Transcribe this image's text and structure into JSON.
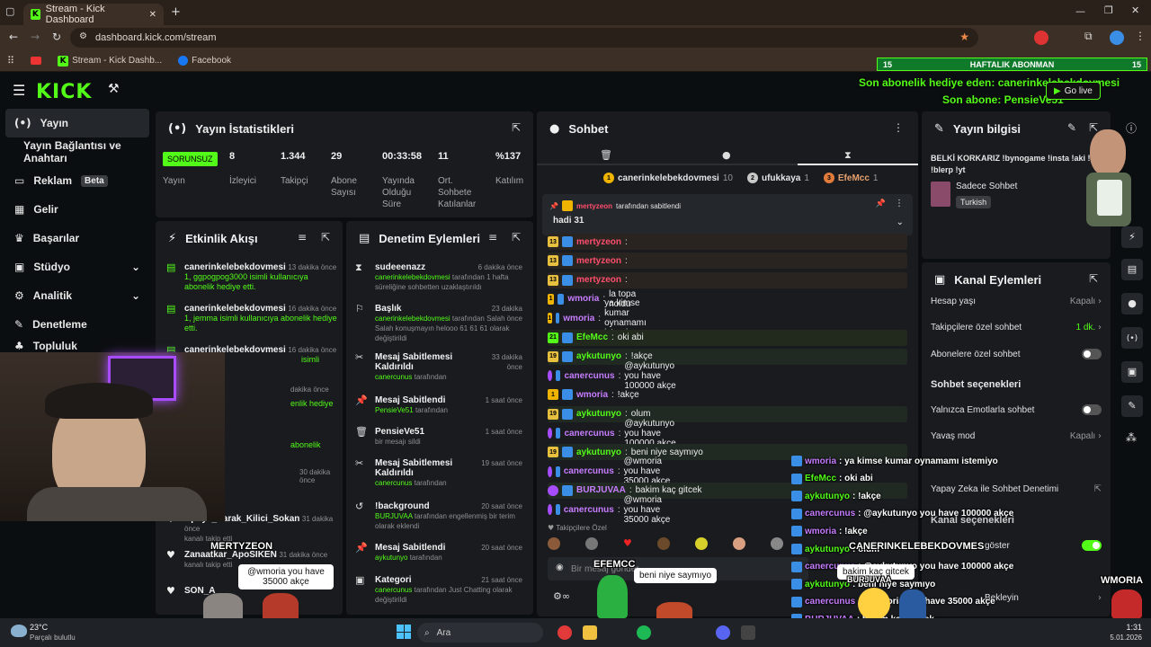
{
  "browser": {
    "tab_title": "Stream - Kick Dashboard",
    "url": "dashboard.kick.com/stream",
    "bookmarks": [
      "Stream - Kick Dashb...",
      "Facebook"
    ]
  },
  "overlay_top": {
    "sub_goal_left": "15",
    "sub_goal_label": "HAFTALIK ABONMAN",
    "sub_goal_right": "15",
    "gift_line": "Son abonelik hediye eden: canerinkelebekdovmesi",
    "sub_line": "Son abone: PensieVe51",
    "go_live": "Go live"
  },
  "sidebar": {
    "items": [
      {
        "label": "Yayın",
        "icon": "broadcast-icon"
      },
      {
        "label": "Yayın Bağlantısı ve Anahtarı",
        "icon": ""
      },
      {
        "label": "Reklam",
        "icon": "ad-icon",
        "badge": "Beta"
      },
      {
        "label": "Gelir",
        "icon": "chart-icon"
      },
      {
        "label": "Başarılar",
        "icon": "trophy-icon"
      },
      {
        "label": "Stüdyo",
        "icon": "studio-icon"
      },
      {
        "label": "Analitik",
        "icon": "analytics-icon"
      },
      {
        "label": "Denetleme",
        "icon": "wrench-icon"
      },
      {
        "label": "Topluluk",
        "icon": "community-icon"
      }
    ]
  },
  "stats": {
    "title": "Yayın İstatistikleri",
    "status": "SORUNSUZ",
    "status_label": "Yayın",
    "items": [
      {
        "value": "8",
        "label": "İzleyici"
      },
      {
        "value": "1.344",
        "label": "Takipçi"
      },
      {
        "value": "29",
        "label": "Abone Sayısı"
      },
      {
        "value": "00:33:58",
        "label": "Yayında Olduğu Süre"
      },
      {
        "value": "11",
        "label": "Ort. Sohbete Katılanlar"
      },
      {
        "value": "%137",
        "label": "Katılım"
      }
    ]
  },
  "activity": {
    "title": "Etkinlik Akışı",
    "items": [
      {
        "name": "canerinkelebekdovmesi",
        "time": "13 dakika önce",
        "desc": "1, ggpogpog3000 isimli kullanıcıya abonelik hediye etti."
      },
      {
        "name": "canerinkelebekdovmesi",
        "time": "16 dakika önce",
        "desc": "1, jemma isimli kullanıcıya abonelik hediye etti."
      },
      {
        "name": "canerinkelebekdovmesi",
        "time": "16 dakika önce",
        "desc": "isimli"
      },
      {
        "name": "Apoya_Sarak_Kilici_Sokan",
        "time": "31 dakika önce",
        "desc": "kanalı takip etti"
      },
      {
        "name": "Zanaatkar_ApoSIKEN",
        "time": "31 dakika önce",
        "desc": "kanalı takip etti"
      },
      {
        "name": "SON_A",
        "time": "",
        "desc": ""
      }
    ],
    "extra_times": [
      "dakika önce",
      "dakika önce",
      "30 dakika önce"
    ],
    "extra_desc": [
      "enlik hediye",
      "abonelik"
    ]
  },
  "moderation": {
    "title": "Denetim Eylemleri",
    "items": [
      {
        "name": "sudeeenazz",
        "time": "6 dakika önce",
        "desc_hl": "canerinkelebekdovmesi",
        "desc": "tarafından 1 hafta süreliğine sohbetten uzaklaştırıldı",
        "icon": "hourglass-icon"
      },
      {
        "name": "Başlık",
        "time": "23 dakika önce",
        "desc_hl": "canerinkelebekdovmesi",
        "desc": "tarafından Salah Salah konuşmayın helooo 61 61 61 olarak değiştirildi",
        "icon": "title-icon"
      },
      {
        "name": "Mesaj Sabitlemesi Kaldırıldı",
        "time": "33 dakika önce",
        "desc_hl": "canercunus",
        "desc": "tarafından",
        "icon": "unpin-icon"
      },
      {
        "name": "Mesaj Sabitlendi",
        "time": "1 saat önce",
        "desc_hl": "PensieVe51",
        "desc": "tarafından",
        "icon": "pin-icon"
      },
      {
        "name": "PensieVe51",
        "time": "1 saat önce",
        "desc_hl": "",
        "desc": "bir mesajı sildi",
        "icon": "trash-icon"
      },
      {
        "name": "Mesaj Sabitlemesi Kaldırıldı",
        "time": "19 saat önce",
        "desc_hl": "canercunus",
        "desc": "tarafından",
        "icon": "unpin-icon"
      },
      {
        "name": "!background",
        "time": "20 saat önce",
        "desc_hl": "BURJUVAA",
        "desc": "tarafından engellenmiş bir terim olarak eklendi",
        "icon": "ban-icon"
      },
      {
        "name": "Mesaj Sabitlendi",
        "time": "20 saat önce",
        "desc_hl": "aykutunyo",
        "desc": "tarafından",
        "icon": "pin-icon"
      },
      {
        "name": "Kategori",
        "time": "21 saat önce",
        "desc_hl": "canercunus",
        "desc": "tarafından Just Chatting olarak değiştirildi",
        "icon": "category-icon"
      }
    ]
  },
  "chat": {
    "title": "Sohbet",
    "top_gifters": [
      {
        "name": "canerinkelebekdovmesi",
        "count": "10",
        "rank": "1",
        "color": "#f0b400"
      },
      {
        "name": "ufukkaya",
        "count": "1",
        "rank": "2",
        "color": "#c8c8c8"
      },
      {
        "name": "EfeMcc",
        "count": "1",
        "rank": "3",
        "color": "#e07b3c"
      }
    ],
    "pinned_by": "mertyzeon",
    "pinned_suffix": "tarafından sabitlendi",
    "pinned_message": "hadi 31",
    "messages": [
      {
        "user": "mertyzeon",
        "text": "",
        "color": "#ff4d6d",
        "badge": "13"
      },
      {
        "user": "mertyzeon",
        "text": "",
        "color": "#ff4d6d",
        "badge": "13"
      },
      {
        "user": "mertyzeon",
        "text": "",
        "color": "#ff4d6d",
        "badge": "13"
      },
      {
        "user": "wmoria",
        "text": "la topa noldu",
        "color": "#c77dff",
        "badge": "1"
      },
      {
        "user": "wmoria",
        "text": "ya kimse kumar oynamamı istemiyo",
        "color": "#c77dff",
        "badge": "1"
      },
      {
        "user": "EfeMcc",
        "text": "oki abi",
        "color": "#53fc18",
        "badge": "21"
      },
      {
        "user": "aykutunyo",
        "text": "!akçe",
        "color": "#53fc18",
        "badge": "19"
      },
      {
        "user": "canercunus",
        "text": "@aykutunyo you have 100000 akçe",
        "color": "#c77dff",
        "badge": ""
      },
      {
        "user": "wmoria",
        "text": "!akçe",
        "color": "#c77dff",
        "badge": "1"
      },
      {
        "user": "aykutunyo",
        "text": "olum",
        "color": "#53fc18",
        "badge": "19"
      },
      {
        "user": "canercunus",
        "text": "@aykutunyo you have 100000 akçe",
        "color": "#c77dff",
        "badge": ""
      },
      {
        "user": "aykutunyo",
        "text": "beni niye saymıyo",
        "color": "#53fc18",
        "badge": "19"
      },
      {
        "user": "canercunus",
        "text": "@wmoria you have 35000 akçe",
        "color": "#c77dff",
        "badge": ""
      },
      {
        "user": "BURJUVAA",
        "text": "bakim kaç gitcek",
        "color": "#c77dff",
        "badge": ""
      },
      {
        "user": "canercunus",
        "text": "@wmoria you have 35000 akçe",
        "color": "#c77dff",
        "badge": ""
      }
    ],
    "followers_only": "Takipçilere Özel",
    "input_placeholder": "Bir mesaj gönder"
  },
  "stream_info": {
    "title": "Yayın bilgisi",
    "stream_title": "BELKİ KORKARIZ !bynogame !insta !aki !dc !blerp !yt",
    "category": "Sadece Sohbet",
    "language": "Turkish"
  },
  "channel_actions": {
    "title": "Kanal Eylemleri",
    "rows": [
      {
        "label": "Hesap yaşı",
        "value": "Kapalı",
        "type": "nav"
      },
      {
        "label": "Takipçilere özel sohbet",
        "value": "1 dk.",
        "type": "nav"
      },
      {
        "label": "Abonelere özel sohbet",
        "value": "",
        "type": "toggle"
      }
    ],
    "chat_options_title": "Sohbet seçenekleri",
    "chat_rows": [
      {
        "label": "Yalnızca Emotlarla sohbet",
        "value": "",
        "type": "toggle"
      },
      {
        "label": "Yavaş mod",
        "value": "Kapalı",
        "type": "nav"
      },
      {
        "label": "Yapay Zeka ile Sohbet Denetimi",
        "value": "",
        "type": "link"
      }
    ],
    "channel_options_title": "Kanal seçenekleri",
    "channel_option_row": "göster",
    "extra_row": "Bekleyin"
  },
  "overlay_chat": [
    {
      "user": "wmoria",
      "text": ": ya kimse kumar oynamamı istemiyo",
      "color": "#c77dff"
    },
    {
      "user": "EfeMcc",
      "text": ": oki abi",
      "color": "#53fc18"
    },
    {
      "user": "aykutunyo",
      "text": ": !akçe",
      "color": "#53fc18"
    },
    {
      "user": "canercunus",
      "text": ": @aykutunyo you have 100000 akçe",
      "color": "#c77dff"
    },
    {
      "user": "wmoria",
      "text": ": !akçe",
      "color": "#c77dff"
    },
    {
      "user": "aykutunyo",
      "text": ": olum",
      "color": "#53fc18"
    },
    {
      "user": "canercunus",
      "text": ": @aykutunyo you have 100000 akçe",
      "color": "#c77dff"
    },
    {
      "user": "aykutunyo",
      "text": ": beni niye saymıyo",
      "color": "#53fc18"
    },
    {
      "user": "canercunus",
      "text": ": @wmoria you have 35000 akçe",
      "color": "#c77dff"
    },
    {
      "user": "BURJUVAA",
      "text": ": bakim kaç gitcek",
      "color": "#c77dff"
    },
    {
      "user": "canercunus",
      "text": ": @wmoria you have 35000 akçe",
      "color": "#c77dff"
    }
  ],
  "overlay_chars": {
    "mertyzeon": "MERTYZEON",
    "mertyzeon_bubble": "@wmoria you have 35000 akçe",
    "efemcc": "EFEMCC",
    "efemcc_bubble": "beni niye saymıyo",
    "caner": "CANERINKELEBEKDOVMES",
    "burj_bubble": "bakim kaç gitcek",
    "burj": "BURJUVAA",
    "wmoria": "WMORIA"
  },
  "taskbar": {
    "temp": "23°C",
    "weather": "Parçalı bulutlu",
    "search": "Ara",
    "time": "1:31",
    "date": "5.01.2026"
  },
  "colors": {
    "accent": "#53fc18",
    "panel": "#191b1f",
    "bg": "#0b0e10"
  }
}
